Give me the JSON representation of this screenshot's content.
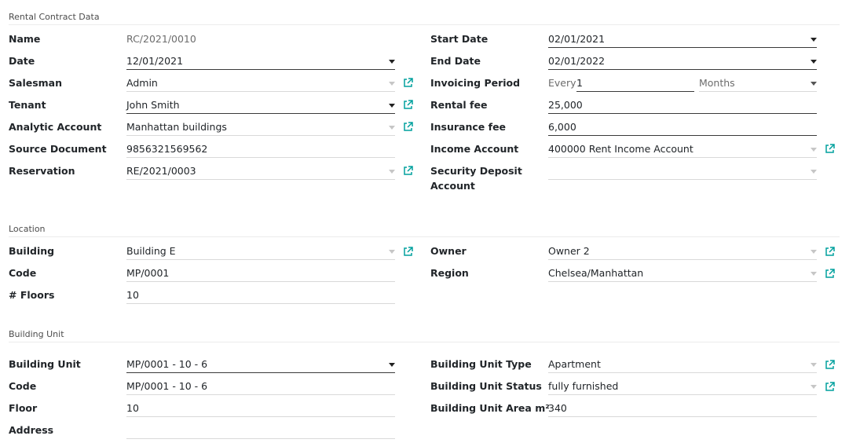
{
  "sections": {
    "rental": "Rental Contract Data",
    "location": "Location",
    "unit": "Building Unit"
  },
  "rental": {
    "name": {
      "label": "Name",
      "value": "RC/2021/0010"
    },
    "date": {
      "label": "Date",
      "value": "12/01/2021"
    },
    "salesman": {
      "label": "Salesman",
      "value": "Admin"
    },
    "tenant": {
      "label": "Tenant",
      "value": "John Smith"
    },
    "analytic_account": {
      "label": "Analytic Account",
      "value": "Manhattan buildings"
    },
    "source_document": {
      "label": "Source Document",
      "value": "9856321569562"
    },
    "reservation": {
      "label": "Reservation",
      "value": "RE/2021/0003"
    },
    "start_date": {
      "label": "Start Date",
      "value": "02/01/2021"
    },
    "end_date": {
      "label": "End Date",
      "value": "02/01/2022"
    },
    "invoicing_period": {
      "label": "Invoicing Period",
      "every": "Every",
      "count": "1",
      "unit": "Months"
    },
    "rental_fee": {
      "label": "Rental fee",
      "value": "25,000"
    },
    "insurance_fee": {
      "label": "Insurance fee",
      "value": "6,000"
    },
    "income_account": {
      "label": "Income Account",
      "value": "400000 Rent Income Account"
    },
    "security_deposit_account": {
      "label_line1": "Security Deposit",
      "label_line2": "Account",
      "value": ""
    }
  },
  "location": {
    "building": {
      "label": "Building",
      "value": "Building E"
    },
    "code": {
      "label": "Code",
      "value": "MP/0001"
    },
    "floors": {
      "label": "# Floors",
      "value": "10"
    },
    "owner": {
      "label": "Owner",
      "value": "Owner 2"
    },
    "region": {
      "label": "Region",
      "value": "Chelsea/Manhattan"
    }
  },
  "unit": {
    "building_unit": {
      "label": "Building Unit",
      "value": "MP/0001 - 10 - 6"
    },
    "code": {
      "label": "Code",
      "value": "MP/0001 - 10 - 6"
    },
    "floor": {
      "label": "Floor",
      "value": "10"
    },
    "address": {
      "label": "Address",
      "value": ""
    },
    "unit_type": {
      "label": "Building Unit Type",
      "value": "Apartment"
    },
    "unit_status": {
      "label": "Building Unit Status",
      "value": "fully furnished"
    },
    "unit_area": {
      "label": "Building Unit Area m²",
      "value": "340"
    }
  },
  "icons": {
    "external_link": "external-link-icon",
    "dropdown": "chevron-down-icon"
  },
  "colors": {
    "accent": "#00a09d",
    "text": "#212529",
    "muted": "#6c6c6c"
  }
}
